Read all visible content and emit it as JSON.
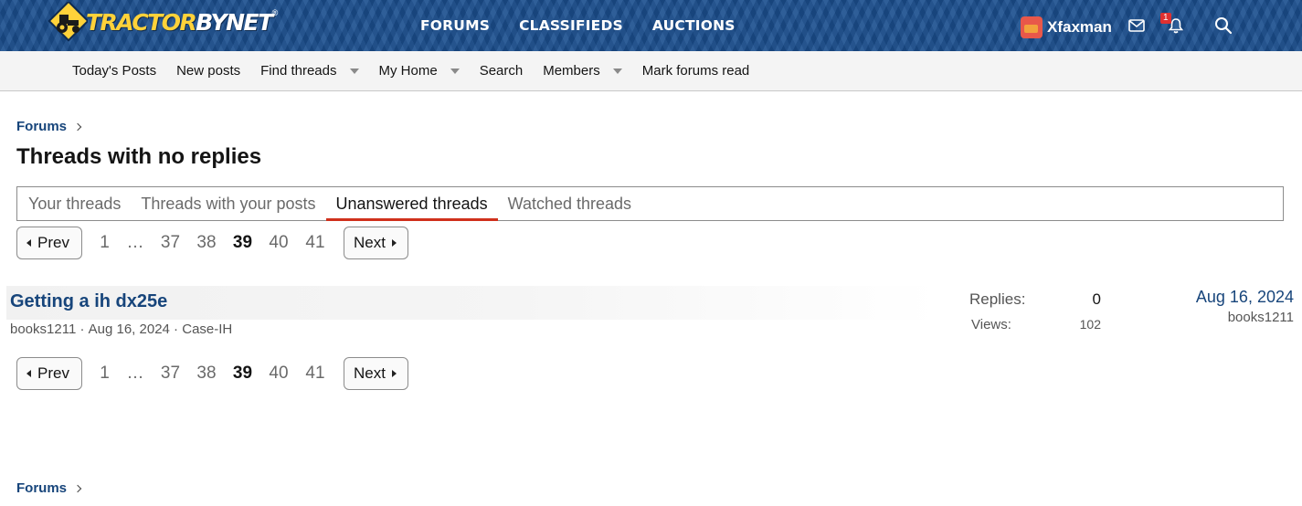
{
  "header": {
    "logo": {
      "text_main": "TRACTOR",
      "text_by": "BYNET"
    },
    "nav": [
      {
        "label": "FORUMS"
      },
      {
        "label": "CLASSIFIEDS"
      },
      {
        "label": "AUCTIONS"
      }
    ],
    "user": {
      "name": "Xfaxman"
    },
    "alerts_count": "1",
    "icons": [
      "inbox-icon",
      "bell-icon",
      "search-icon"
    ]
  },
  "subnav": {
    "items": [
      {
        "label": "Today's Posts",
        "dropdown": false
      },
      {
        "label": "New posts",
        "dropdown": false
      },
      {
        "label": "Find threads",
        "dropdown": true
      },
      {
        "label": "My Home",
        "dropdown": true
      },
      {
        "label": "Search",
        "dropdown": false
      },
      {
        "label": "Members",
        "dropdown": true
      },
      {
        "label": "Mark forums read",
        "dropdown": false
      }
    ]
  },
  "breadcrumb": {
    "label": "Forums"
  },
  "page_title": "Threads with no replies",
  "tabs": [
    {
      "label": "Your threads",
      "active": false
    },
    {
      "label": "Threads with your posts",
      "active": false
    },
    {
      "label": "Unanswered threads",
      "active": true
    },
    {
      "label": "Watched threads",
      "active": false
    }
  ],
  "pager": {
    "prev": "Prev",
    "next": "Next",
    "pages": [
      "1",
      "…",
      "37",
      "38",
      "39",
      "40",
      "41"
    ],
    "current": "39"
  },
  "thread": {
    "title": "Getting a ih dx25e",
    "author": "books1211",
    "date": "Aug 16, 2024",
    "forum": "Case-IH",
    "replies_label": "Replies:",
    "replies": "0",
    "views_label": "Views:",
    "views": "102",
    "last_date": "Aug 16, 2024",
    "last_user": "books1211"
  },
  "colors": {
    "header_bg": "#1b4f8f",
    "link": "#17457b",
    "tab_accent": "#d0301c",
    "logo_yellow": "#ffd23a"
  }
}
